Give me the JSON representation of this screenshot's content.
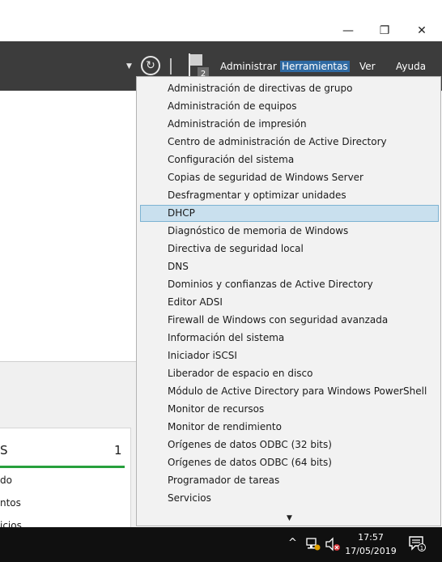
{
  "window": {
    "minimize_glyph": "—",
    "maximize_glyph": "❐",
    "close_glyph": "✕"
  },
  "commandbar": {
    "flag_badge": "2",
    "menus": [
      "Administrar",
      "Herramientas",
      "Ver",
      "Ayuda"
    ],
    "active_menu": "Herramientas"
  },
  "background_card": {
    "title": "S",
    "count": "1",
    "rows": [
      "do",
      "ntos",
      "icios"
    ]
  },
  "dropdown": {
    "selected_item": "DHCP",
    "items": [
      "Administración de directivas de grupo",
      "Administración de equipos",
      "Administración de impresión",
      "Centro de administración de Active Directory",
      "Configuración del sistema",
      "Copias de seguridad de Windows Server",
      "Desfragmentar y optimizar unidades",
      "DHCP",
      "Diagnóstico de memoria de Windows",
      "Directiva de seguridad local",
      "DNS",
      "Dominios y confianzas de Active Directory",
      "Editor ADSI",
      "Firewall de Windows con seguridad avanzada",
      "Información del sistema",
      "Iniciador iSCSI",
      "Liberador de espacio en disco",
      "Módulo de Active Directory para Windows PowerShell",
      "Monitor de recursos",
      "Monitor de rendimiento",
      "Orígenes de datos ODBC (32 bits)",
      "Orígenes de datos ODBC (64 bits)",
      "Programador de tareas",
      "Servicios"
    ],
    "more_indicator": "▼"
  },
  "taskbar": {
    "time": "17:57",
    "date": "17/05/2019",
    "notification_count": "1"
  },
  "colors": {
    "commandbar": "#3c3c3c",
    "active_menu": "#2f6aa3",
    "selection": "#c9e0ee",
    "selection_border": "#7db3d3",
    "progress_green": "#27a03c",
    "taskbar": "#101010"
  }
}
